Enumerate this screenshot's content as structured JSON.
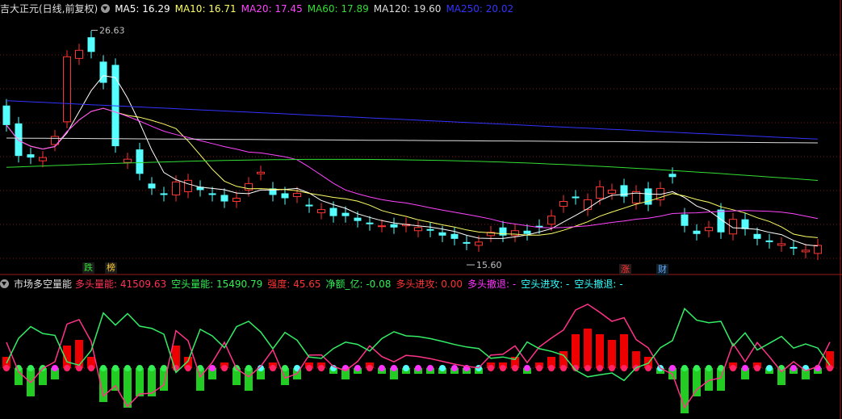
{
  "main_legend": {
    "title": "吉大正元(日线,前复权)",
    "items": [
      {
        "label": "MA5: 16.29",
        "color": "#ffffff"
      },
      {
        "label": "MA10: 16.71",
        "color": "#ffff66"
      },
      {
        "label": "MA20: 17.45",
        "color": "#ff44ff"
      },
      {
        "label": "MA60: 17.89",
        "color": "#33dd33"
      },
      {
        "label": "MA120: 19.60",
        "color": "#dddddd"
      },
      {
        "label": "MA250: 20.02",
        "color": "#3333ff"
      }
    ]
  },
  "price_labels": {
    "high": "26.63",
    "low": "15.60"
  },
  "event_tags": [
    {
      "label": "跌",
      "color": "#33dd33",
      "bg": "#1a1a1a"
    },
    {
      "label": "榜",
      "color": "#ffcc33",
      "bg": "#1a1a1a"
    },
    {
      "label": "涨",
      "color": "#ff3333",
      "bg": "#2a1a1a"
    },
    {
      "label": "财",
      "color": "#66aaff",
      "bg": "#10202a"
    }
  ],
  "indicator_legend": {
    "title": "市场多空量能",
    "items": [
      {
        "label": "多头量能: 41509.63",
        "color": "#ff3355"
      },
      {
        "label": "空头量能: 15490.79",
        "color": "#33ee55"
      },
      {
        "label": "强度: 45.65",
        "color": "#ff3333"
      },
      {
        "label": "净额_亿: -0.08",
        "color": "#33ee55"
      },
      {
        "label": "多头进攻: 0.00",
        "color": "#ff3333"
      },
      {
        "label": "多头撤退: -",
        "color": "#ff33ff"
      },
      {
        "label": "空头进攻: -",
        "color": "#33ffff"
      },
      {
        "label": "空头撤退: -",
        "color": "#33ffff"
      }
    ]
  },
  "colors": {
    "up": "#ff3333",
    "down": "#55ffff",
    "grid": "#7a1a1a"
  },
  "chart_data": {
    "type": "candlestick",
    "title": "吉大正元(日线,前复权)",
    "price_high": 26.63,
    "price_low": 15.6,
    "candles": [
      {
        "o": 22.0,
        "c": 20.8
      },
      {
        "o": 20.9,
        "c": 18.9
      },
      {
        "o": 19.0,
        "c": 18.8
      },
      {
        "o": 18.6,
        "c": 18.8
      },
      {
        "o": 19.6,
        "c": 20.1
      },
      {
        "o": 21.0,
        "c": 25.0
      },
      {
        "o": 24.9,
        "c": 25.4
      },
      {
        "o": 26.2,
        "c": 25.3
      },
      {
        "o": 24.7,
        "c": 23.4
      },
      {
        "o": 24.5,
        "c": 19.5
      },
      {
        "o": 18.5,
        "c": 18.7
      },
      {
        "o": 19.3,
        "c": 17.8
      },
      {
        "o": 17.2,
        "c": 16.9
      },
      {
        "o": 16.6,
        "c": 16.5
      },
      {
        "o": 16.5,
        "c": 17.3
      },
      {
        "o": 16.7,
        "c": 17.4
      },
      {
        "o": 17.0,
        "c": 16.8
      },
      {
        "o": 16.6,
        "c": 16.5
      },
      {
        "o": 16.5,
        "c": 16.1
      },
      {
        "o": 16.1,
        "c": 16.3
      },
      {
        "o": 16.8,
        "c": 17.2
      },
      {
        "o": 17.8,
        "c": 17.9
      },
      {
        "o": 16.9,
        "c": 16.5
      },
      {
        "o": 16.6,
        "c": 16.3
      },
      {
        "o": 16.4,
        "c": 16.6
      },
      {
        "o": 15.9,
        "c": 15.8
      },
      {
        "o": 15.4,
        "c": 15.6
      },
      {
        "o": 15.7,
        "c": 15.2
      },
      {
        "o": 15.4,
        "c": 15.2
      },
      {
        "o": 15.1,
        "c": 14.9
      },
      {
        "o": 14.8,
        "c": 14.7
      },
      {
        "o": 14.6,
        "c": 14.6
      },
      {
        "o": 14.7,
        "c": 14.5
      },
      {
        "o": 14.6,
        "c": 14.7
      },
      {
        "o": 14.3,
        "c": 14.5
      },
      {
        "o": 14.4,
        "c": 14.3
      },
      {
        "o": 14.2,
        "c": 14.0
      },
      {
        "o": 14.1,
        "c": 13.8
      },
      {
        "o": 13.6,
        "c": 13.5
      },
      {
        "o": 13.4,
        "c": 13.6
      },
      {
        "o": 14.0,
        "c": 14.2
      },
      {
        "o": 14.5,
        "c": 14.0
      },
      {
        "o": 14.0,
        "c": 14.3
      },
      {
        "o": 14.3,
        "c": 14.1
      },
      {
        "o": 14.6,
        "c": 14.5
      },
      {
        "o": 14.7,
        "c": 15.2
      },
      {
        "o": 15.8,
        "c": 16.1
      },
      {
        "o": 16.4,
        "c": 16.3
      },
      {
        "o": 15.6,
        "c": 16.2
      },
      {
        "o": 16.3,
        "c": 17.0
      },
      {
        "o": 16.6,
        "c": 16.8
      },
      {
        "o": 17.1,
        "c": 16.4
      },
      {
        "o": 16.0,
        "c": 16.7
      },
      {
        "o": 16.9,
        "c": 15.9
      },
      {
        "o": 16.2,
        "c": 16.9
      },
      {
        "o": 17.8,
        "c": 17.6
      },
      {
        "o": 15.3,
        "c": 14.6
      },
      {
        "o": 14.3,
        "c": 14.1
      },
      {
        "o": 14.3,
        "c": 14.5
      },
      {
        "o": 15.6,
        "c": 14.2
      },
      {
        "o": 14.1,
        "c": 15.0
      },
      {
        "o": 15.0,
        "c": 14.4
      },
      {
        "o": 14.1,
        "c": 13.8
      },
      {
        "o": 13.7,
        "c": 13.6
      },
      {
        "o": 13.4,
        "c": 13.5
      },
      {
        "o": 13.3,
        "c": 13.2
      },
      {
        "o": 13.0,
        "c": 13.1
      },
      {
        "o": 12.9,
        "c": 13.4
      }
    ],
    "indicator": {
      "bars": [
        2,
        -3,
        -5,
        -3,
        -2,
        4,
        5,
        2,
        -6,
        -4,
        -7,
        -5,
        -5,
        -4,
        4,
        2,
        -4,
        -2,
        1,
        -3,
        -4,
        -2,
        1,
        -3,
        -2,
        1,
        1,
        -1,
        -2,
        -1,
        1,
        -1,
        -2,
        -1,
        -1,
        -1,
        -1,
        -1,
        -1,
        -1,
        1,
        1,
        2,
        -1,
        1,
        2,
        3,
        6,
        7,
        6,
        5,
        6,
        3,
        2,
        -1,
        -2,
        -8,
        -5,
        -4,
        -4,
        1,
        -2,
        1,
        -1,
        -3,
        -1,
        -2,
        -1,
        3
      ]
    }
  }
}
